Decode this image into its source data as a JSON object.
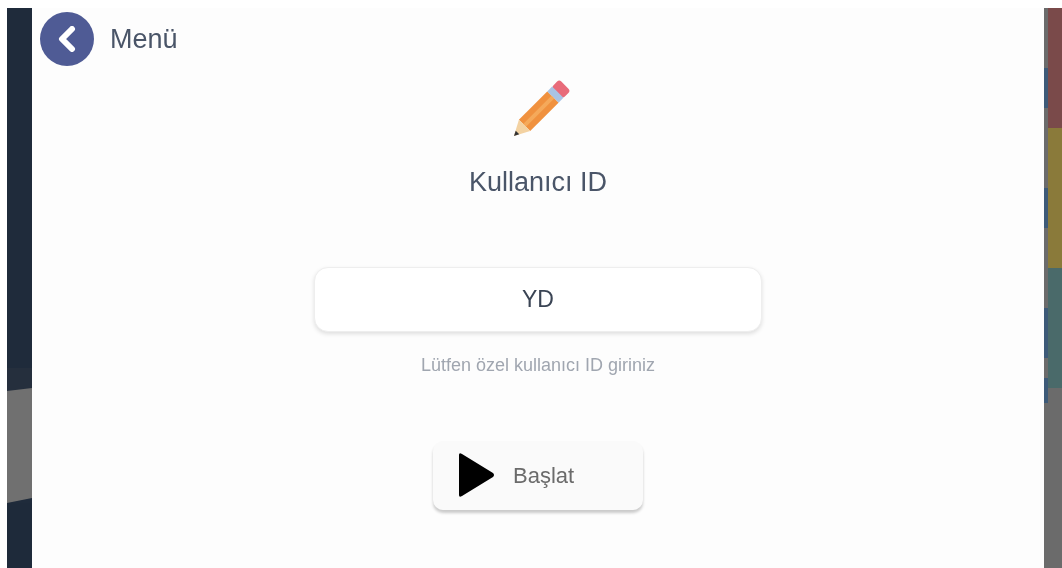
{
  "header": {
    "back_label": "Menü"
  },
  "title": "Kullanıcı ID",
  "id_field": {
    "value": "YD"
  },
  "hint": "Lütfen özel kullanıcı ID giriniz",
  "start_button": {
    "label": "Başlat"
  }
}
